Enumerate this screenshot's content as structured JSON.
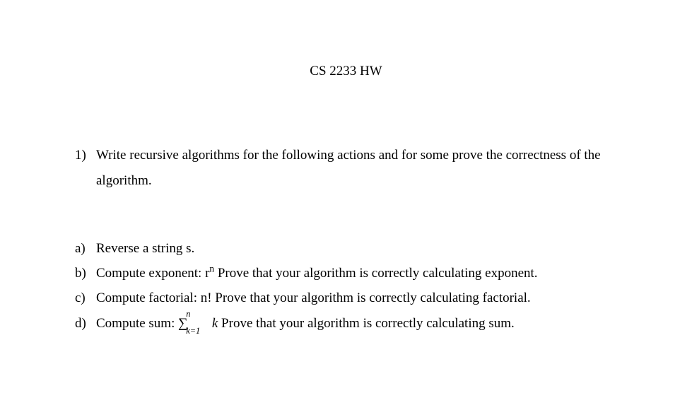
{
  "title": "CS 2233 HW",
  "question": {
    "number": "1)",
    "text": "Write recursive algorithms for the following actions and for some prove the correctness of the algorithm."
  },
  "subitems": [
    {
      "label": "a)",
      "prefix": "Reverse a string s.",
      "rest": ""
    },
    {
      "label": "b)",
      "prefix": "Compute exponent: r",
      "sup": "n",
      "rest": " Prove that your algorithm is correctly calculating exponent."
    },
    {
      "label": "c)",
      "prefix": "Compute factorial: n!  Prove that your algorithm is correctly calculating factorial.",
      "rest": ""
    },
    {
      "label": "d)",
      "prefix": "Compute sum: ",
      "sigma": {
        "symbol": "∑",
        "upper": "n",
        "lower": "k=1",
        "var": "k"
      },
      "rest": " Prove that your algorithm is correctly calculating sum."
    }
  ]
}
